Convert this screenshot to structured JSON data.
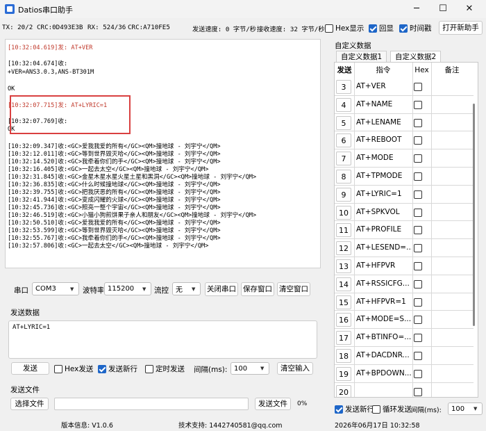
{
  "window": {
    "title": "Datios串口助手",
    "minimize": "─",
    "maximize": "☐",
    "close": "✕"
  },
  "status": {
    "tx": "TX: 20/2",
    "tx_crc": "CRC:0D493E3B",
    "rx": "RX: 524/36",
    "rx_crc": "CRC:A710FE5",
    "send_speed": "发送速度: 0 字节/秒",
    "recv_speed": "接收速度: 32 字节/秒",
    "hex_display": "Hex显示",
    "echo": "回显",
    "timestamp": "时间戳",
    "open_new": "打开新助手"
  },
  "log": {
    "l1": "[10:32:04.619]发: AT+VER",
    "l2": "[10:32:04.674]收:",
    "l3": "+VER=ANS3.0.3,ANS-BT301M",
    "l4": "OK",
    "l5": "[10:32:07.715]发: AT+LYRIC=1",
    "l6": "[10:32:07.769]收:",
    "l7": "OK",
    "l8": "[10:32:09.347]收:<GC>爱我我爱的所有</GC><QM>撞地球 - 刘宇宁</QM>",
    "l9": "[10:32:12.011]收:<GC>等到世界毁灭哈</GC><QM>撞地球 - 刘宇宁</QM>",
    "l10": "[10:32:14.520]收:<GC>我牵着你们的手</GC><QM>撞地球 - 刘宇宁</QM>",
    "l11": "[10:32:16.405]收:<GC>一起去太空</GC><QM>撞地球 - 刘宇宁</QM>",
    "l12": "[10:32:31.845]收:<GC>金星木星水星火星土星和黑洞</GC><QM>撞地球 - 刘宇宁</QM>",
    "l13": "[10:32:36.835]收:<GC>什么时候撞地球</GC><QM>撞地球 - 刘宇宁</QM>",
    "l14": "[10:32:39.755]收:<GC>把我厌恶的所有</GC><QM>撞地球 - 刘宇宁</QM>",
    "l15": "[10:32:41.944]收:<GC>变成闪耀的火球</GC><QM>撞地球 - 刘宇宁</QM>",
    "l16": "[10:32:45.736]收:<GC>照亮一整个宇宙</GC><QM>撞地球 - 刘宇宁</QM>",
    "l17": "[10:32:46.519]收:<GC>小猫小狗煎饼果子亲人和朋友</GC><QM>撞地球 - 刘宇宁</QM>",
    "l18": "[10:32:50.510]收:<GC>爱我我爱的所有</GC><QM>撞地球 - 刘宇宁</QM>",
    "l19": "[10:32:53.599]收:<GC>等到世界毁灭哈</GC><QM>撞地球 - 刘宇宁</QM>",
    "l20": "[10:32:55.767]收:<GC>我牵着你们的手</GC><QM>撞地球 - 刘宇宁</QM>",
    "l21": "[10:32:57.806]收:<GC>一起去太空</GC><QM>撞地球 - 刘宇宁</QM>"
  },
  "port": {
    "port_label": "串口",
    "port_value": "COM3",
    "baud_label": "波特率",
    "baud_value": "115200",
    "flow_label": "流控",
    "flow_value": "无",
    "close_port": "关闭串口",
    "save_window": "保存窗口",
    "clear_window": "清空窗口"
  },
  "send": {
    "section_label": "发送数据",
    "text": "AT+LYRIC=1",
    "send_btn": "发送",
    "hex_send": "Hex发送",
    "new_line": "发送新行",
    "timed": "定时发送",
    "interval_label": "间隔(ms):",
    "interval_value": "100",
    "clear_input": "清空输入"
  },
  "file": {
    "section_label": "发送文件",
    "choose": "选择文件",
    "path": "",
    "send_file": "发送文件",
    "progress": "0%"
  },
  "footer": {
    "version": "版本信息: V1.0.6",
    "support": "技术支持: 1442740581@qq.com",
    "datetime": "2026年06月17日 10:32:58"
  },
  "custom": {
    "section_label": "自定义数据",
    "tab1": "自定义数据1",
    "tab2": "自定义数据2",
    "col_send": "发送",
    "col_cmd": "指令",
    "col_hex": "Hex",
    "col_note": "备注",
    "rows": [
      {
        "n": "3",
        "cmd": "AT+VER"
      },
      {
        "n": "4",
        "cmd": "AT+NAME"
      },
      {
        "n": "5",
        "cmd": "AT+LENAME"
      },
      {
        "n": "6",
        "cmd": "AT+REBOOT"
      },
      {
        "n": "7",
        "cmd": "AT+MODE"
      },
      {
        "n": "8",
        "cmd": "AT+TPMODE"
      },
      {
        "n": "9",
        "cmd": "AT+LYRIC=1"
      },
      {
        "n": "10",
        "cmd": "AT+SPKVOL"
      },
      {
        "n": "11",
        "cmd": "AT+PROFILE"
      },
      {
        "n": "12",
        "cmd": "AT+LESEND=..."
      },
      {
        "n": "13",
        "cmd": "AT+HFPVR"
      },
      {
        "n": "14",
        "cmd": "AT+RSSICFG..."
      },
      {
        "n": "15",
        "cmd": "AT+HFPVR=1"
      },
      {
        "n": "16",
        "cmd": "AT+MODE=S..."
      },
      {
        "n": "17",
        "cmd": "AT+BTINFO=..."
      },
      {
        "n": "18",
        "cmd": "AT+DACDNR..."
      },
      {
        "n": "19",
        "cmd": "AT+BPDOWN..."
      },
      {
        "n": "20",
        "cmd": ""
      }
    ],
    "send_newline": "发送新行",
    "loop_send": "循环发送",
    "interval_label": "间隔(ms):",
    "interval_value": "100"
  }
}
